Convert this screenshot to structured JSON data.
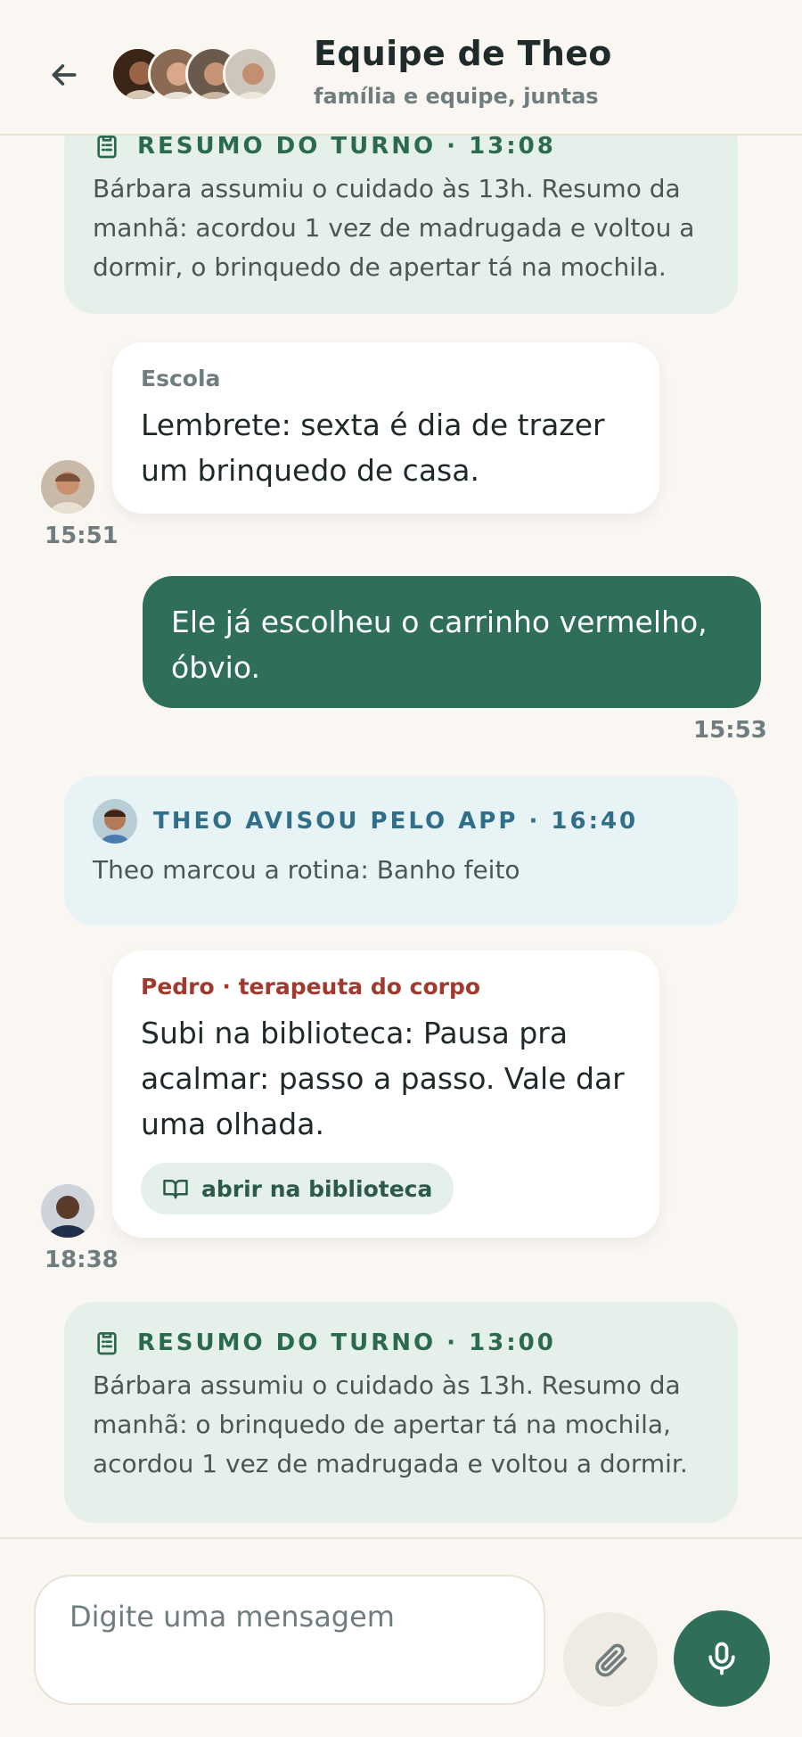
{
  "header": {
    "title": "Equipe de Theo",
    "subtitle": "família e equipe, juntas",
    "avatars": [
      "avatar-1",
      "avatar-2",
      "avatar-3",
      "avatar-4"
    ]
  },
  "messages": {
    "summary_top": {
      "heading": "RESUMO DO TURNO · 13:08",
      "body": "Bárbara assumiu o cuidado às 13h. Resumo da manhã: acordou 1 vez de madrugada e voltou a dormir, o brinquedo de apertar tá na mochila."
    },
    "school": {
      "sender": "Escola",
      "text": "Lembrete: sexta é dia de trazer um brinquedo de casa.",
      "time": "15:51"
    },
    "outgoing": {
      "text": "Ele já escolheu o carrinho vermelho, óbvio.",
      "time": "15:53"
    },
    "app_notice": {
      "heading": "THEO AVISOU PELO APP · 16:40",
      "body": "Theo marcou a rotina: Banho feito"
    },
    "pedro": {
      "sender": "Pedro · terapeuta do corpo",
      "text": "Subi na biblioteca: Pausa pra acalmar: passo a passo. Vale dar uma olhada.",
      "link_label": "abrir na biblioteca",
      "time": "18:38"
    },
    "summary_bottom": {
      "heading": "RESUMO DO TURNO · 13:00",
      "body": "Bárbara assumiu o cuidado às 13h. Resumo da manhã: o brinquedo de apertar tá na mochila, acordou 1 vez de madrugada e voltou a dormir."
    }
  },
  "composer": {
    "placeholder": "Digite uma mensagem"
  },
  "colors": {
    "accent": "#2f6f5a",
    "summary_bg": "#e6f0eb",
    "app_bg": "#e8f3f5",
    "pedro_name": "#a03a2e"
  }
}
